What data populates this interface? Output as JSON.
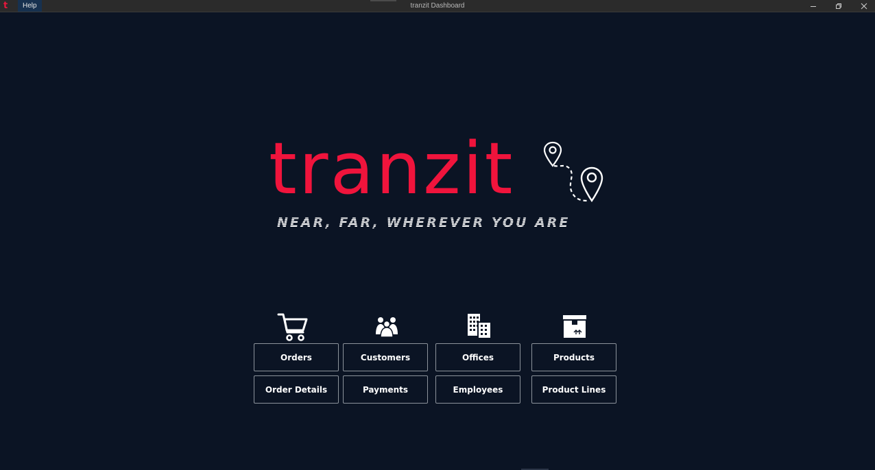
{
  "window": {
    "title": "tranzit Dashboard",
    "app_icon_letter": "t",
    "menu": [
      {
        "label": "Help"
      }
    ],
    "controls": [
      "minimize-icon",
      "restore-icon",
      "close-icon"
    ]
  },
  "logo": {
    "word": "tranzit",
    "tagline": "NEAR, FAR, WHEREVER YOU ARE",
    "brand_color": "#f0143c"
  },
  "categories": [
    {
      "icon": "shopping-cart-icon",
      "buttons": [
        "Orders",
        "Order Details"
      ]
    },
    {
      "icon": "people-icon",
      "buttons": [
        "Customers",
        "Payments"
      ]
    },
    {
      "icon": "office-buildings-icon",
      "buttons": [
        "Offices",
        "Employees"
      ]
    },
    {
      "icon": "product-box-icon",
      "buttons": [
        "Products",
        "Product Lines"
      ]
    }
  ],
  "colors": {
    "background": "#0b1424",
    "titlebar": "#2b2b2b",
    "button_border": "#8d949c"
  }
}
